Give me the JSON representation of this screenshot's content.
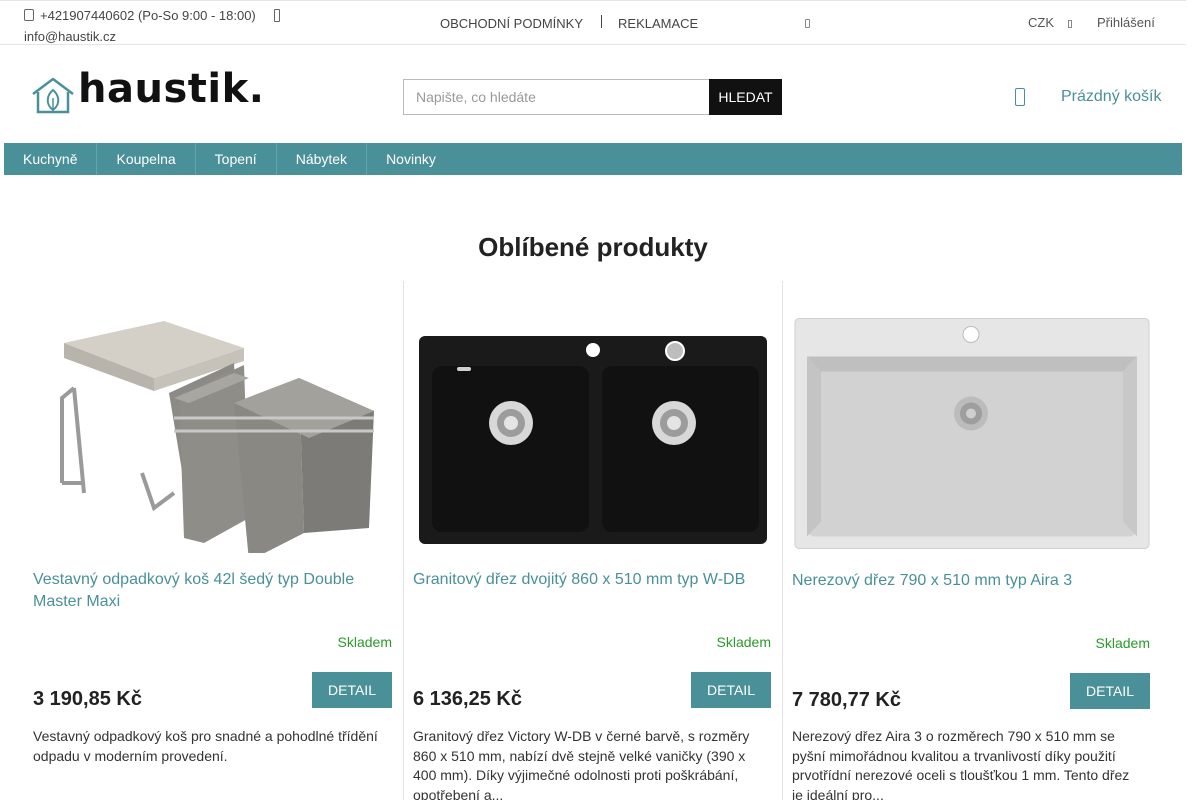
{
  "topbar": {
    "phone": "+421907440602 (Po-So 9:00 - 18:00)",
    "email": "info@haustik.cz",
    "links": [
      "OBCHODNÍ PODMÍNKY",
      "REKLAMACE"
    ],
    "currency": "CZK",
    "login": "Přihlášení"
  },
  "header": {
    "logo_text": "haustik.",
    "search_placeholder": "Napište, co hledáte",
    "search_button": "HLEDAT",
    "cart_label": "Prázdný košík"
  },
  "nav": {
    "items": [
      "Kuchyně",
      "Koupelna",
      "Topení",
      "Nábytek",
      "Novinky"
    ]
  },
  "section": {
    "title": "Oblíbené produkty"
  },
  "products": [
    {
      "name": "Vestavný odpadkový koš 42l šedý typ Double Master Maxi",
      "stock": "Skladem",
      "price": "3 190,85 Kč",
      "button": "DETAIL",
      "description": "Vestavný odpadkový koš pro snadné a pohodlné třídění odpadu v moderním provedení."
    },
    {
      "name": "Granitový dřez dvojitý 860 x 510 mm typ W-DB",
      "stock": "Skladem",
      "price": "6 136,25 Kč",
      "button": "DETAIL",
      "description": "Granitový dřez Victory W-DB v černé barvě, s rozměry 860 x 510 mm, nabízí dvě stejně velké vaničky (390 x 400 mm). Díky výjimečné odolnosti proti poškrábání, opotřebení a..."
    },
    {
      "name": "Nerezový dřez 790 x 510 mm typ Aira 3",
      "stock": "Skladem",
      "price": "7 780,77 Kč",
      "button": "DETAIL",
      "description": "Nerezový dřez Aira 3 o rozměrech 790 x 510 mm se pyšní mimořádnou kvalitou a trvanlivostí díky použití prvotřídní nerezové oceli s tloušťkou 1 mm. Tento dřez je ideální pro..."
    }
  ],
  "colors": {
    "accent": "#4a9099",
    "stock": "#2a9a2a",
    "search_button": "#111111"
  }
}
